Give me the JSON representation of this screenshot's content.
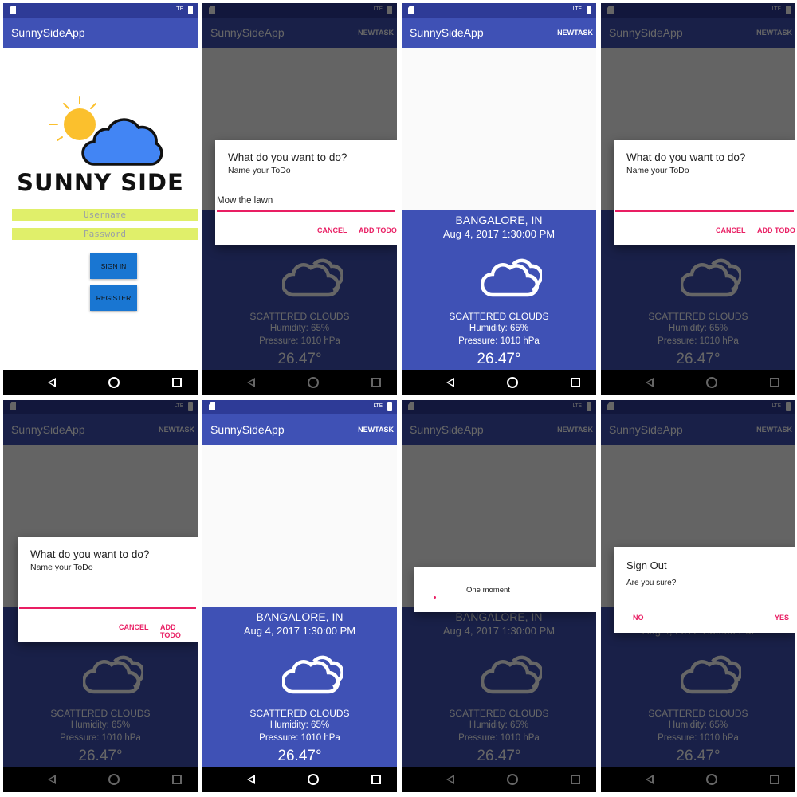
{
  "app": {
    "title": "SunnySideApp",
    "new_task": "NEWTASK"
  },
  "status": {
    "network": "LTE"
  },
  "login": {
    "logo_text": "SUNNY SIDE",
    "username_placeholder": "Username",
    "password_placeholder": "Password",
    "sign_in": "SIGN IN",
    "register": "REGISTER"
  },
  "weather": {
    "city": "BANGALORE, IN",
    "datetime": "Aug 4, 2017 1:30:00 PM",
    "description": "SCATTERED CLOUDS",
    "humidity": "Humidity: 65%",
    "pressure": "Pressure: 1010 hPa",
    "temperature": "26.47°",
    "icon": "cloud-icon"
  },
  "todo_dialog": {
    "title": "What do you want to do?",
    "message": "Name your ToDo",
    "input_value": "Mow the lawn",
    "cancel": "CANCEL",
    "confirm": "ADD TODO"
  },
  "progress": {
    "message": "One moment"
  },
  "signout_dialog": {
    "title": "Sign Out",
    "message": "Are you sure?",
    "no": "NO",
    "yes": "YES"
  },
  "colors": {
    "primary": "#3f51b5",
    "primary_dark": "#2e3b97",
    "accent": "#e91e63",
    "button": "#1976d2",
    "field": "#e0ef6a",
    "sun": "#fbc02d",
    "cloud": "#4285f4"
  }
}
